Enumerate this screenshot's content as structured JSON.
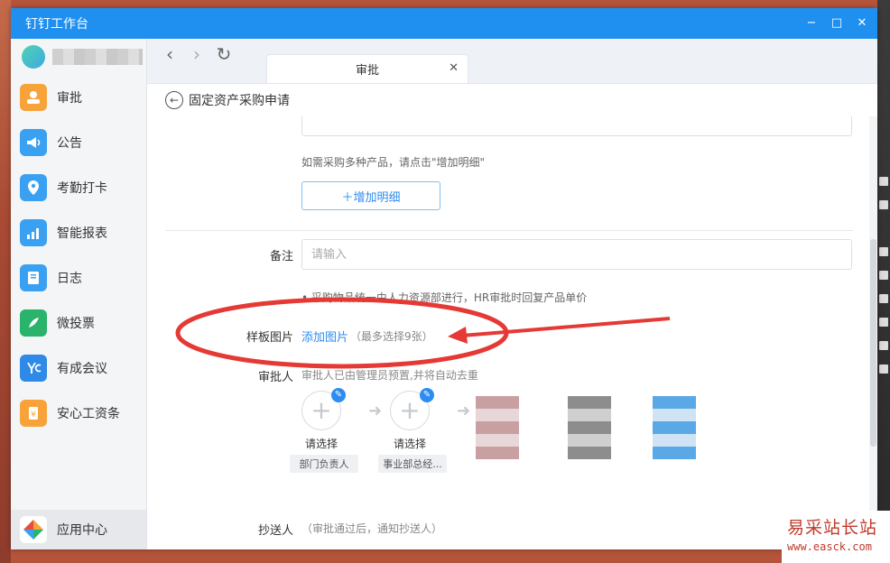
{
  "window": {
    "title": "钉钉工作台",
    "controls": {
      "minimize": "−",
      "maximize": "□",
      "close": "✕"
    }
  },
  "sidebar": {
    "items": [
      {
        "label": "审批",
        "icon": "approval-icon",
        "color": "#f7a33a"
      },
      {
        "label": "公告",
        "icon": "megaphone-icon",
        "color": "#3aa1f2"
      },
      {
        "label": "考勤打卡",
        "icon": "location-pin-icon",
        "color": "#3aa1f2"
      },
      {
        "label": "智能报表",
        "icon": "chart-icon",
        "color": "#3aa1f2"
      },
      {
        "label": "日志",
        "icon": "notebook-icon",
        "color": "#3aa1f2"
      },
      {
        "label": "微投票",
        "icon": "vote-icon",
        "color": "#2ab36a"
      },
      {
        "label": "有成会议",
        "icon": "meeting-icon",
        "color": "#2e8ae6"
      },
      {
        "label": "安心工资条",
        "icon": "payslip-icon",
        "color": "#f7a33a"
      }
    ],
    "bottom_item": {
      "label": "应用中心",
      "icon": "app-center-icon"
    }
  },
  "browser": {
    "tab_label": "审批",
    "tab_close": "✕"
  },
  "page": {
    "title": "固定资产采购申请"
  },
  "form": {
    "multi_product_hint": "如需采购多种产品，请点击\"增加明细\"",
    "add_detail_label": "＋增加明细",
    "remark": {
      "label": "备注",
      "placeholder": "请输入"
    },
    "note": "• 采购物品统一由人力资源部进行，HR审批时回复产品单价",
    "sample_image": {
      "label": "样板图片",
      "link": "添加图片",
      "hint": "（最多选择9张）"
    },
    "approver": {
      "label": "审批人",
      "hint": "审批人已由管理员预置,并将自动去重",
      "slots": [
        {
          "label": "请选择",
          "role": "部门负责人"
        },
        {
          "label": "请选择",
          "role": "事业部总经..."
        }
      ]
    },
    "cc": {
      "label": "抄送人",
      "hint": "（审批通过后，通知抄送人）"
    }
  },
  "watermark": {
    "title": "易采站长站",
    "url": "www.easck.com"
  },
  "colors": {
    "titlebar": "#1f8ff0",
    "link": "#2d8cf0",
    "annotation": "#e53935"
  }
}
